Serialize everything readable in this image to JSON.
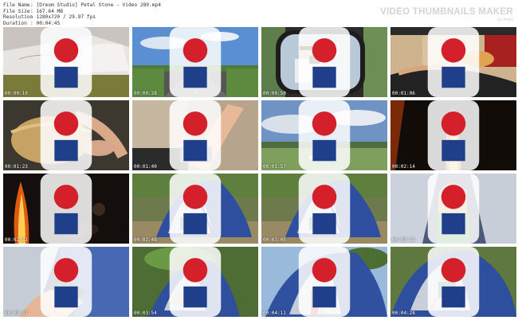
{
  "header": {
    "file_name_key": "File Name",
    "file_name": "[Dreom Studio] Petal Stone - Video 289.mp4",
    "file_size_key": "File Size",
    "file_size": "167.64 MB",
    "resolution_key": "Resolution",
    "resolution": "1280x720 / 29.97 fps",
    "duration_key": "Duration",
    "duration": "00:04:45",
    "separator": ":"
  },
  "brand": {
    "title": "VIDEO THUMBNAILS MAKER",
    "subtitle": "by Andy"
  },
  "thumbnails": [
    {
      "timestamp": "00:00:10",
      "scene": "bed-sheets"
    },
    {
      "timestamp": "00:00:28",
      "scene": "highway"
    },
    {
      "timestamp": "00:00:50",
      "scene": "car-mirror"
    },
    {
      "timestamp": "00:01:06",
      "scene": "car-interior"
    },
    {
      "timestamp": "00:01:23",
      "scene": "hair-closeup"
    },
    {
      "timestamp": "00:01:40",
      "scene": "car-legs"
    },
    {
      "timestamp": "00:01:57",
      "scene": "landscape"
    },
    {
      "timestamp": "00:02:14",
      "scene": "fire-night"
    },
    {
      "timestamp": "00:02:31",
      "scene": "campfire"
    },
    {
      "timestamp": "00:02:48",
      "scene": "tent"
    },
    {
      "timestamp": "00:03:05",
      "scene": "tent"
    },
    {
      "timestamp": "00:03:22",
      "scene": "girl-tent"
    },
    {
      "timestamp": "00:03:37",
      "scene": "inside-tent"
    },
    {
      "timestamp": "00:03:54",
      "scene": "tent-leaves"
    },
    {
      "timestamp": "00:04:11",
      "scene": "tent-front"
    },
    {
      "timestamp": "00:04:28",
      "scene": "tent-girl-sitting"
    }
  ],
  "colors": {
    "brand_text": "#d4d4d4",
    "meta_text": "#333333",
    "timestamp_text": "#ffffff"
  }
}
